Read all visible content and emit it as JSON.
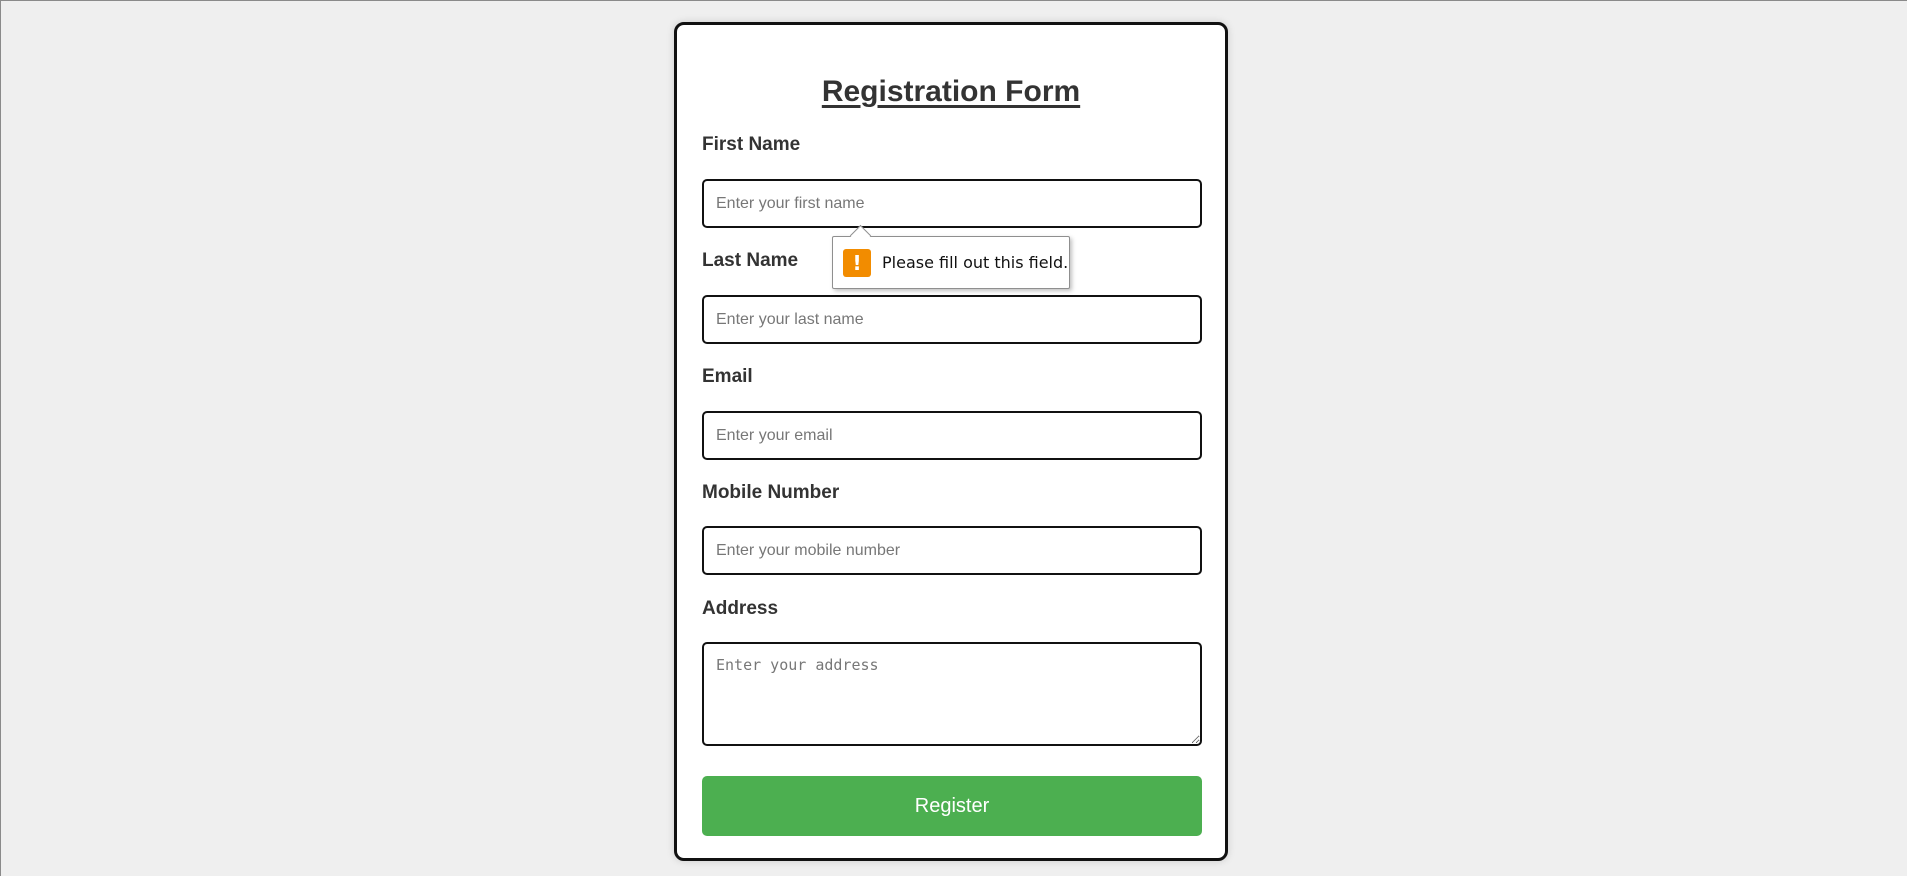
{
  "form": {
    "title": "Registration Form",
    "fields": {
      "first_name": {
        "label": "First Name",
        "placeholder": "Enter your first name",
        "value": ""
      },
      "last_name": {
        "label": "Last Name",
        "placeholder": "Enter your last name",
        "value": ""
      },
      "email": {
        "label": "Email",
        "placeholder": "Enter your email",
        "value": ""
      },
      "mobile": {
        "label": "Mobile Number",
        "placeholder": "Enter your mobile number",
        "value": ""
      },
      "address": {
        "label": "Address",
        "placeholder": "Enter your address",
        "value": ""
      }
    },
    "submit_label": "Register"
  },
  "validation_tooltip": {
    "icon": "warning-icon",
    "icon_glyph": "!",
    "message": "Please fill out this field."
  },
  "colors": {
    "page_background": "#efefef",
    "card_border": "#111111",
    "register_button": "#4caf50",
    "warning_icon": "#f28c00"
  }
}
